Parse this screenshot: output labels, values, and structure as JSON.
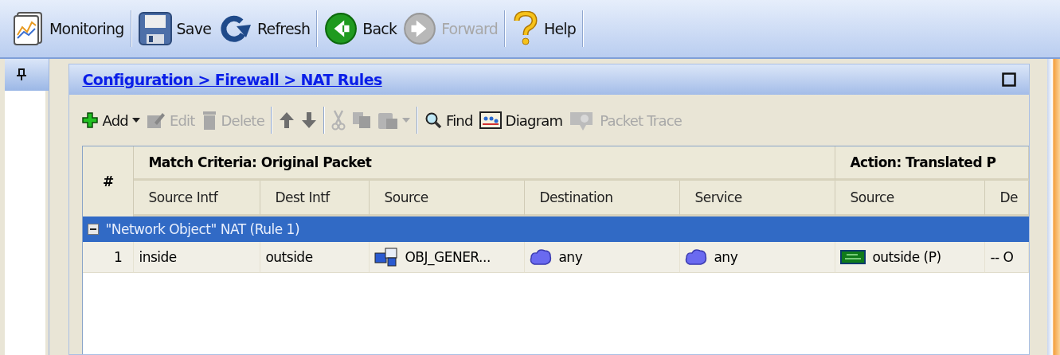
{
  "main_toolbar": [
    [
      {
        "label": "Monitoring",
        "kind": "monitoring",
        "disabled": false
      }
    ],
    [
      {
        "label": "Save",
        "kind": "save",
        "disabled": false
      },
      {
        "label": "Refresh",
        "kind": "refresh",
        "disabled": false
      }
    ],
    [
      {
        "label": "Back",
        "kind": "back",
        "disabled": false
      },
      {
        "label": "Forward",
        "kind": "forward",
        "disabled": true
      }
    ],
    [
      {
        "label": "Help",
        "kind": "help",
        "disabled": false
      }
    ]
  ],
  "breadcrumb": "Configuration > Firewall > NAT Rules",
  "rule_toolbar": [
    [
      {
        "label": "Add",
        "kind": "add",
        "disabled": false
      },
      {
        "label": "Edit",
        "kind": "edit",
        "disabled": true
      },
      {
        "label": "Delete",
        "kind": "delete",
        "disabled": true
      }
    ],
    [
      {
        "kind": "up",
        "disabled": false
      },
      {
        "kind": "down",
        "disabled": false
      }
    ],
    [
      {
        "kind": "cut",
        "disabled": true
      },
      {
        "kind": "copy",
        "disabled": true
      },
      {
        "kind": "paste",
        "disabled": true
      }
    ],
    [
      {
        "label": "Find",
        "kind": "find",
        "disabled": false
      },
      {
        "label": "Diagram",
        "kind": "diagram",
        "disabled": false
      },
      {
        "label": "Packet Trace",
        "kind": "trace",
        "disabled": true
      }
    ]
  ],
  "table": {
    "number_header": "#",
    "groups": [
      "Match Criteria: Original Packet",
      "Action: Translated P"
    ],
    "columns": [
      "Source Intf",
      "Dest Intf",
      "Source",
      "Destination",
      "Service",
      "Source",
      "De"
    ],
    "sections": [
      {
        "label": "\"Network Object\" NAT (Rule 1)",
        "expanded": true,
        "selected": true,
        "rows": [
          {
            "number": "1",
            "cells": [
              {
                "text": "inside",
                "kind": "plain"
              },
              {
                "text": "outside",
                "kind": "plain"
              },
              {
                "text": "OBJ_GENER...",
                "kind": "network-object"
              },
              {
                "text": "any",
                "kind": "any"
              },
              {
                "text": "any",
                "kind": "any"
              },
              {
                "text": "outside (P)",
                "kind": "interface"
              },
              {
                "text": "-- O",
                "kind": "plain"
              }
            ]
          }
        ]
      }
    ]
  }
}
